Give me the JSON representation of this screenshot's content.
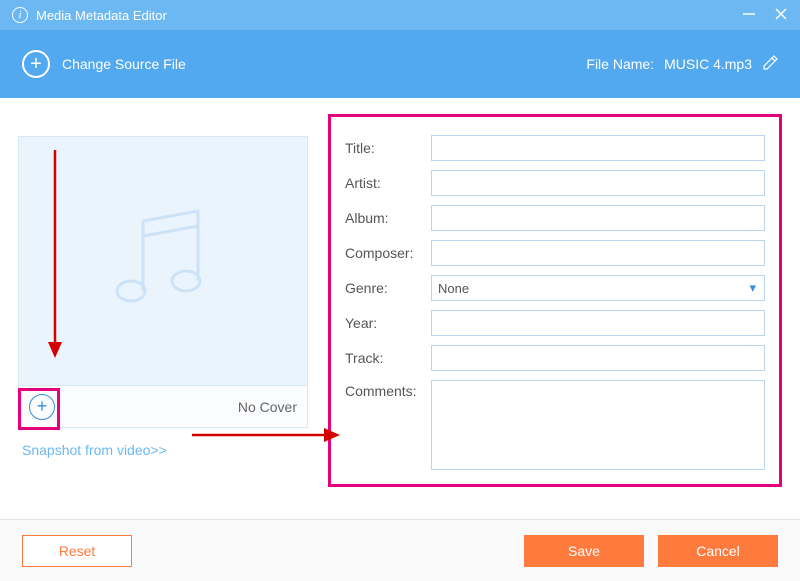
{
  "titlebar": {
    "title": "Media Metadata Editor"
  },
  "toolbar": {
    "change_source_label": "Change Source File",
    "filename_label": "File Name:",
    "filename_value": "MUSIC 4.mp3"
  },
  "cover": {
    "no_cover_label": "No Cover",
    "snapshot_link": "Snapshot from video>>"
  },
  "form": {
    "fields": [
      {
        "label": "Title:",
        "value": ""
      },
      {
        "label": "Artist:",
        "value": ""
      },
      {
        "label": "Album:",
        "value": ""
      },
      {
        "label": "Composer:",
        "value": ""
      }
    ],
    "genre_label": "Genre:",
    "genre_value": "None",
    "year_label": "Year:",
    "year_value": "",
    "track_label": "Track:",
    "track_value": "",
    "comments_label": "Comments:",
    "comments_value": ""
  },
  "footer": {
    "reset_label": "Reset",
    "save_label": "Save",
    "cancel_label": "Cancel"
  }
}
